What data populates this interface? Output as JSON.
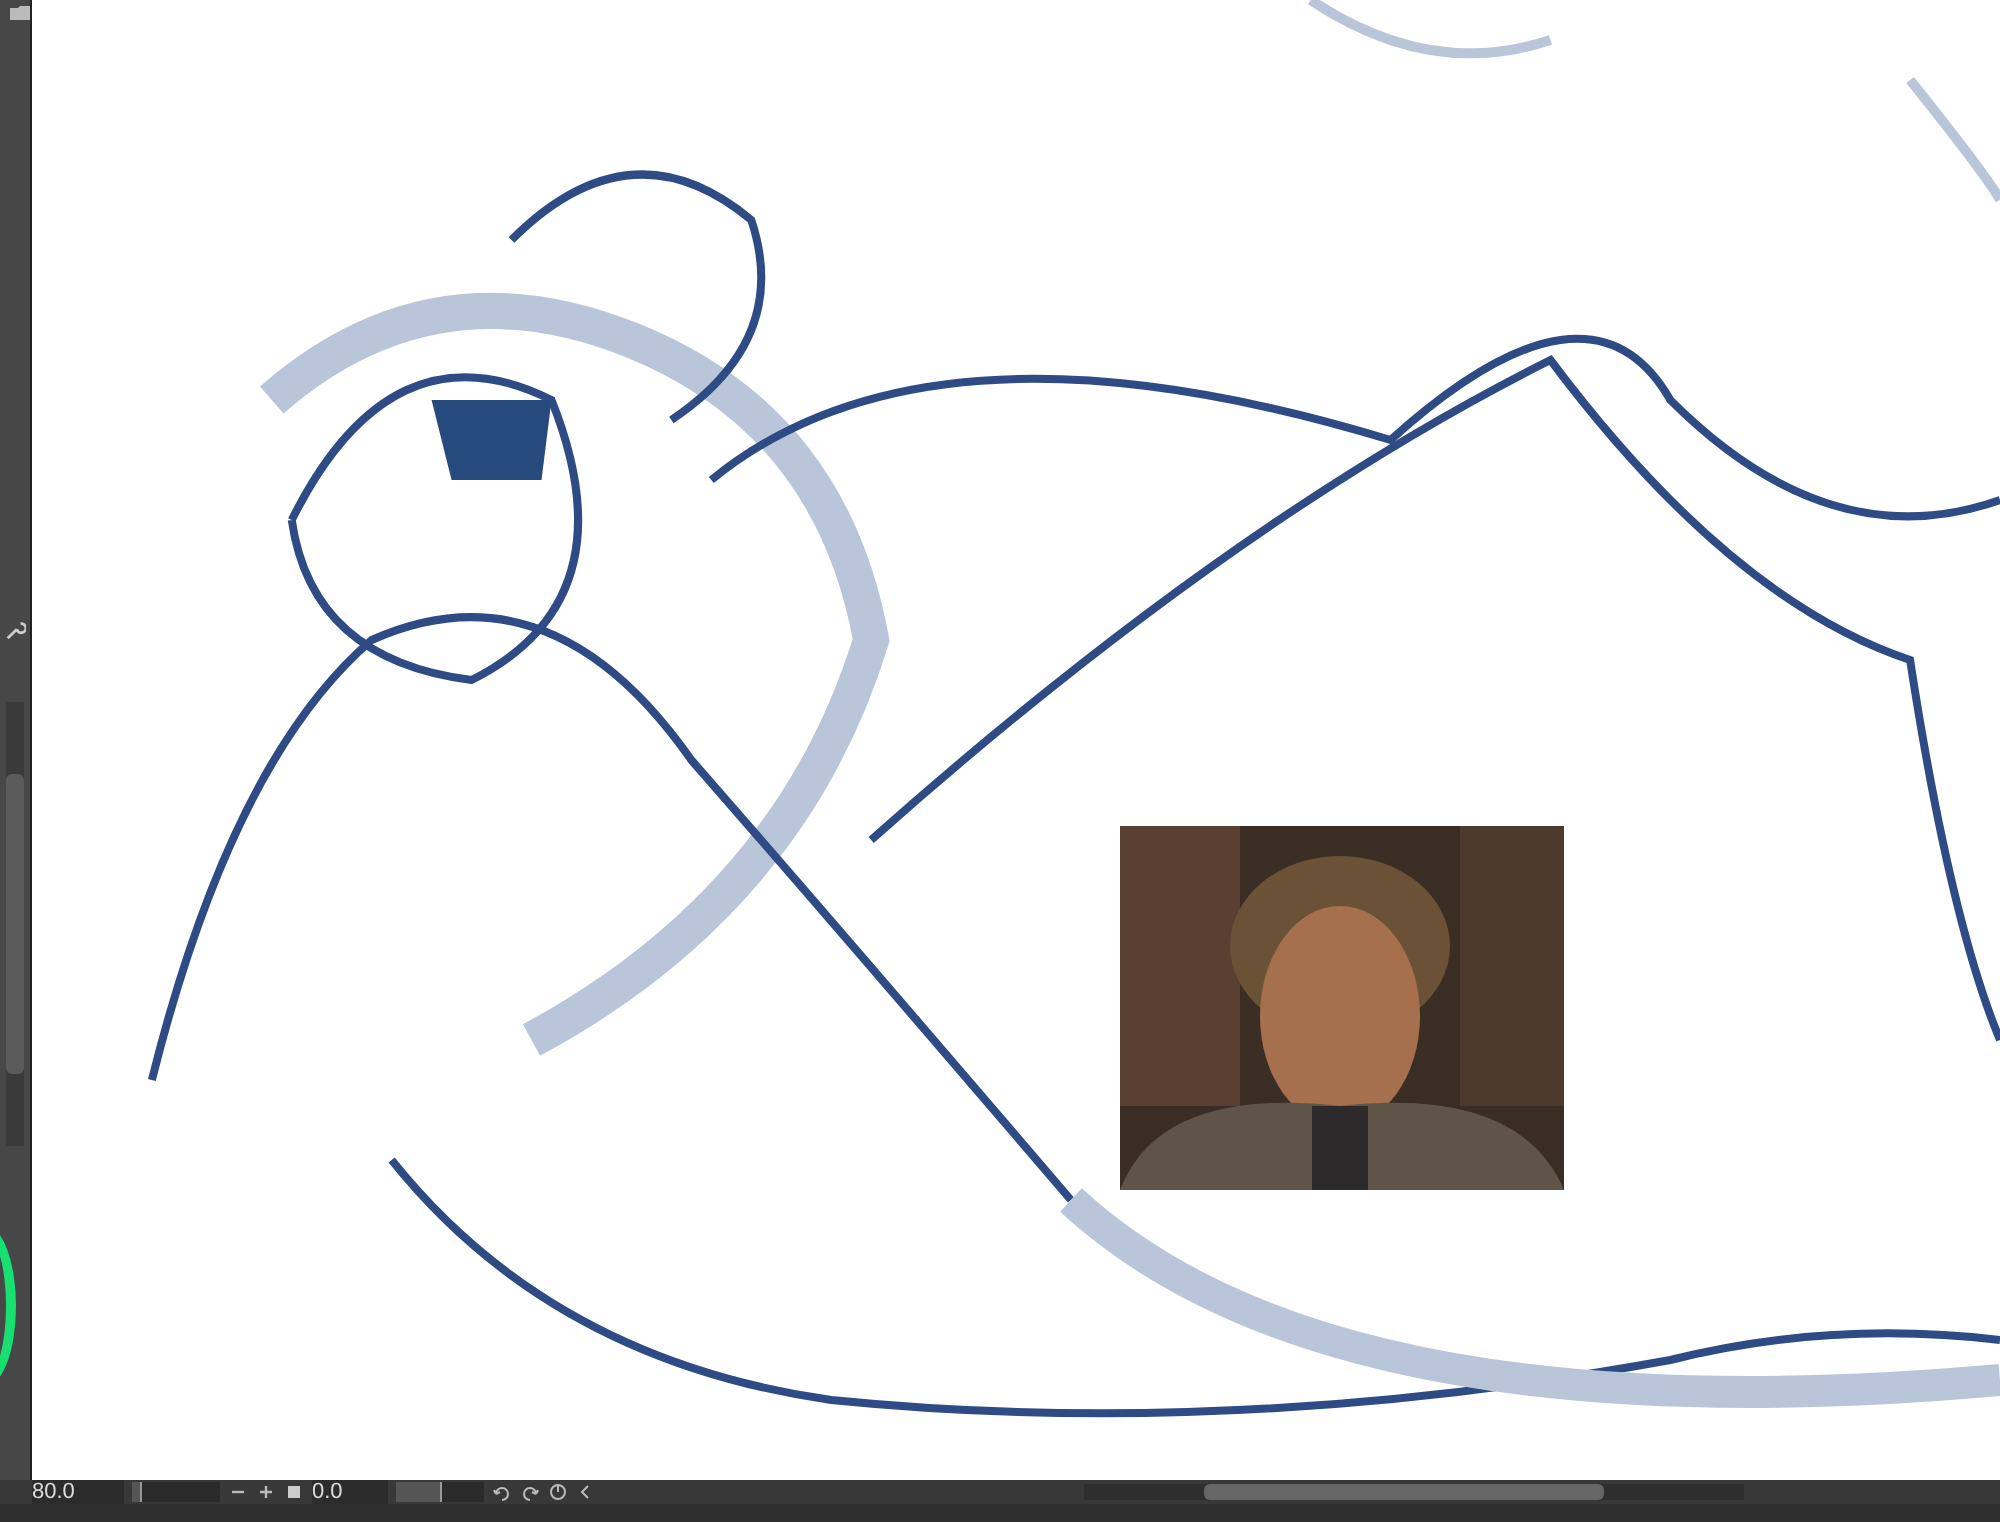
{
  "zoom_field": {
    "value": "80.0"
  },
  "zoom_slider": {
    "level": 0.1
  },
  "rotation_field": {
    "value": "0.0"
  },
  "rotation_slider": {
    "level": 0.5
  }
}
